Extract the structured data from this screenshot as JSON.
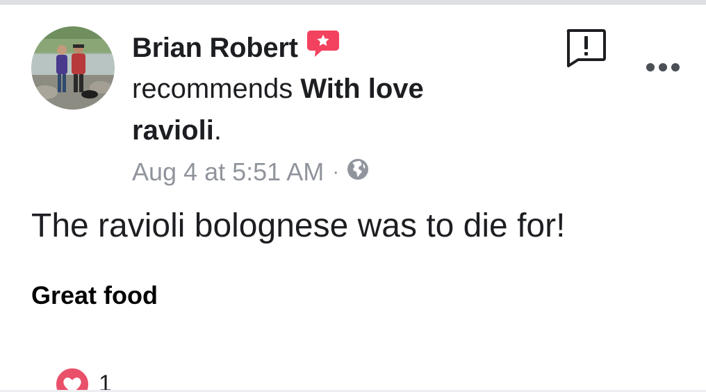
{
  "post": {
    "author": "Brian Robert",
    "verb": "recommends",
    "page_name_line1": "With love",
    "page_name_line2": "ravioli",
    "page_suffix": ".",
    "timestamp": "Aug 4 at 5:51 AM",
    "separator": "·",
    "privacy_icon": "globe-icon",
    "body": "The ravioli bolognese was to die for!",
    "tag": "Great food"
  },
  "reactions": {
    "icon": "love-reaction-icon",
    "count": "1"
  },
  "icons": {
    "badge": "recommendation-badge-icon",
    "report": "report-icon",
    "more": "more-options-icon"
  },
  "colors": {
    "text": "#1c1e21",
    "meta": "#90949c",
    "badge": "#f3425f",
    "love": "#e9506a"
  }
}
